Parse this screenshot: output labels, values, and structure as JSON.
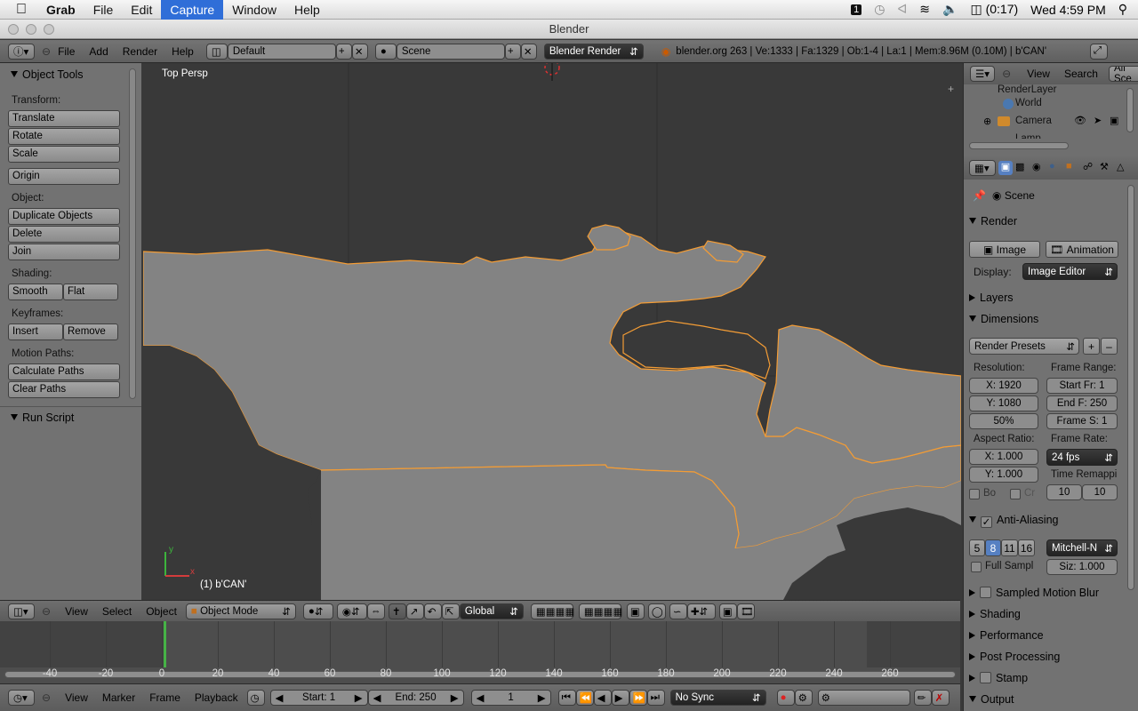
{
  "mac_menu": {
    "app": "Grab",
    "items": [
      "File",
      "Edit",
      "Capture",
      "Window",
      "Help"
    ],
    "selected": "Capture",
    "battery": "(0:17)",
    "clock": "Wed 4:59 PM"
  },
  "window": {
    "title": "Blender"
  },
  "info_header": {
    "menus": [
      "File",
      "Add",
      "Render",
      "Help"
    ],
    "layout": "Default",
    "scene": "Scene",
    "engine": "Blender Render",
    "stats": "blender.org 263 | Ve:1333 | Fa:1329 | Ob:1-4 | La:1 | Mem:8.96M (0.10M) | b'CAN'"
  },
  "toolshelf": {
    "title": "Object Tools",
    "transform_label": "Transform:",
    "transform": [
      "Translate",
      "Rotate",
      "Scale"
    ],
    "origin": "Origin",
    "object_label": "Object:",
    "object": [
      "Duplicate Objects",
      "Delete",
      "Join"
    ],
    "shading_label": "Shading:",
    "shading": [
      "Smooth",
      "Flat"
    ],
    "keyframes_label": "Keyframes:",
    "keyframes": [
      "Insert",
      "Remove"
    ],
    "motion_label": "Motion Paths:",
    "motion": [
      "Calculate Paths",
      "Clear Paths"
    ],
    "run_script": "Run Script"
  },
  "viewport": {
    "view_label": "Top Persp",
    "object_label": "(1) b'CAN'",
    "axis_x": "x",
    "axis_y": "y"
  },
  "outliner": {
    "menus": [
      "View",
      "Search"
    ],
    "filter": "All Sce",
    "items": [
      "RenderLayer",
      "World",
      "Camera",
      "Lamp"
    ]
  },
  "properties": {
    "context": "Scene",
    "render": {
      "title": "Render",
      "image": "Image",
      "animation": "Animation",
      "display_label": "Display:",
      "display_value": "Image Editor"
    },
    "layers": "Layers",
    "dimensions": {
      "title": "Dimensions",
      "presets": "Render Presets",
      "resolution_label": "Resolution:",
      "res_x": "X: 1920",
      "res_y": "Y: 1080",
      "res_pct": "50%",
      "frame_range_label": "Frame Range:",
      "start": "Start Fr: 1",
      "end": "End F: 250",
      "step": "Frame S: 1",
      "aspect_label": "Aspect Ratio:",
      "asp_x": "X: 1.000",
      "asp_y": "Y: 1.000",
      "frame_rate_label": "Frame Rate:",
      "fps": "24 fps",
      "time_remap_label": "Time Remappi",
      "remap_old": "10",
      "remap_new": "10",
      "border": "Bo",
      "crop": "Cr"
    },
    "anti_aliasing": {
      "title": "Anti-Aliasing",
      "samples": [
        "5",
        "8",
        "11",
        "16"
      ],
      "selected": "8",
      "filter": "Mitchell-N",
      "full_sample": "Full Sampl",
      "size": "Siz: 1.000"
    },
    "collapsed": [
      "Sampled Motion Blur",
      "Shading",
      "Performance",
      "Post Processing",
      "Stamp",
      "Output"
    ]
  },
  "view3d_header": {
    "menus": [
      "View",
      "Select",
      "Object"
    ],
    "mode": "Object Mode",
    "orientation": "Global"
  },
  "timeline": {
    "ruler": [
      "-40",
      "-20",
      "0",
      "20",
      "40",
      "60",
      "80",
      "100",
      "120",
      "140",
      "160",
      "180",
      "200",
      "220",
      "240",
      "260"
    ],
    "current_frame_marker": 0
  },
  "timeline_header": {
    "menus": [
      "View",
      "Marker",
      "Frame",
      "Playback"
    ],
    "start": "Start: 1",
    "end": "End: 250",
    "current": "1",
    "sync": "No Sync"
  },
  "colors": {
    "accent": "#5680c2",
    "object_outline": "#f39c35",
    "land": "#838383",
    "viewport_bg": "#393939"
  }
}
